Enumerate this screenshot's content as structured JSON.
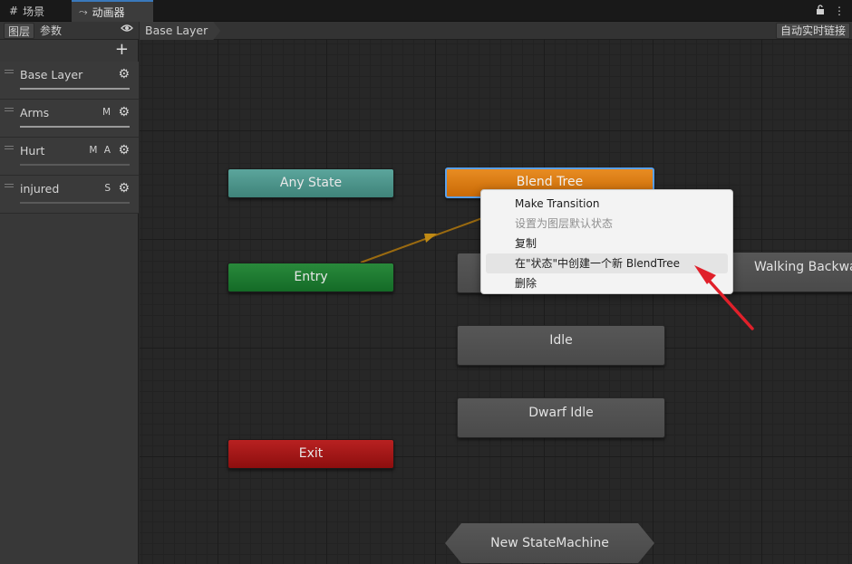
{
  "tabs": {
    "scene_label": "场景",
    "animator_label": "动画器",
    "scene_icon": "#",
    "animator_icon": "⤳"
  },
  "window_controls": {
    "lock_icon": "🔓",
    "menu_icon": "⋮"
  },
  "left_panel": {
    "layers_tab": "图层",
    "params_tab": "参数",
    "add_symbol": "+",
    "layers": [
      {
        "name": "Base Layer",
        "flags": ""
      },
      {
        "name": "Arms",
        "flags": "M"
      },
      {
        "name": "Hurt",
        "flags": "M A"
      },
      {
        "name": "injured",
        "flags": "S"
      }
    ]
  },
  "breadcrumb": {
    "current": "Base Layer"
  },
  "toolbar": {
    "auto_live_link": "自动实时链接"
  },
  "states": {
    "any_state": "Any State",
    "entry": "Entry",
    "exit": "Exit",
    "blend_tree": "Blend Tree",
    "idle": "Idle",
    "dwarf_idle": "Dwarf Idle",
    "walking_backward": "Walking Backwa",
    "new_state_machine": "New StateMachine"
  },
  "context_menu": {
    "items": [
      {
        "label": "Make Transition",
        "enabled": true
      },
      {
        "label": "设置为图层默认状态",
        "enabled": false
      },
      {
        "label": "复制",
        "enabled": true
      },
      {
        "label": "在\"状态\"中创建一个新 BlendTree",
        "enabled": true
      },
      {
        "label": "删除",
        "enabled": true
      }
    ]
  },
  "colors": {
    "any_state": "#4e958b",
    "entry": "#1d7a30",
    "exit": "#a11717",
    "blend_tree": "#d87a10",
    "selection_outline": "#5aa0ea",
    "annotation_arrow": "#e0202a",
    "transition": "#9a6a10"
  }
}
